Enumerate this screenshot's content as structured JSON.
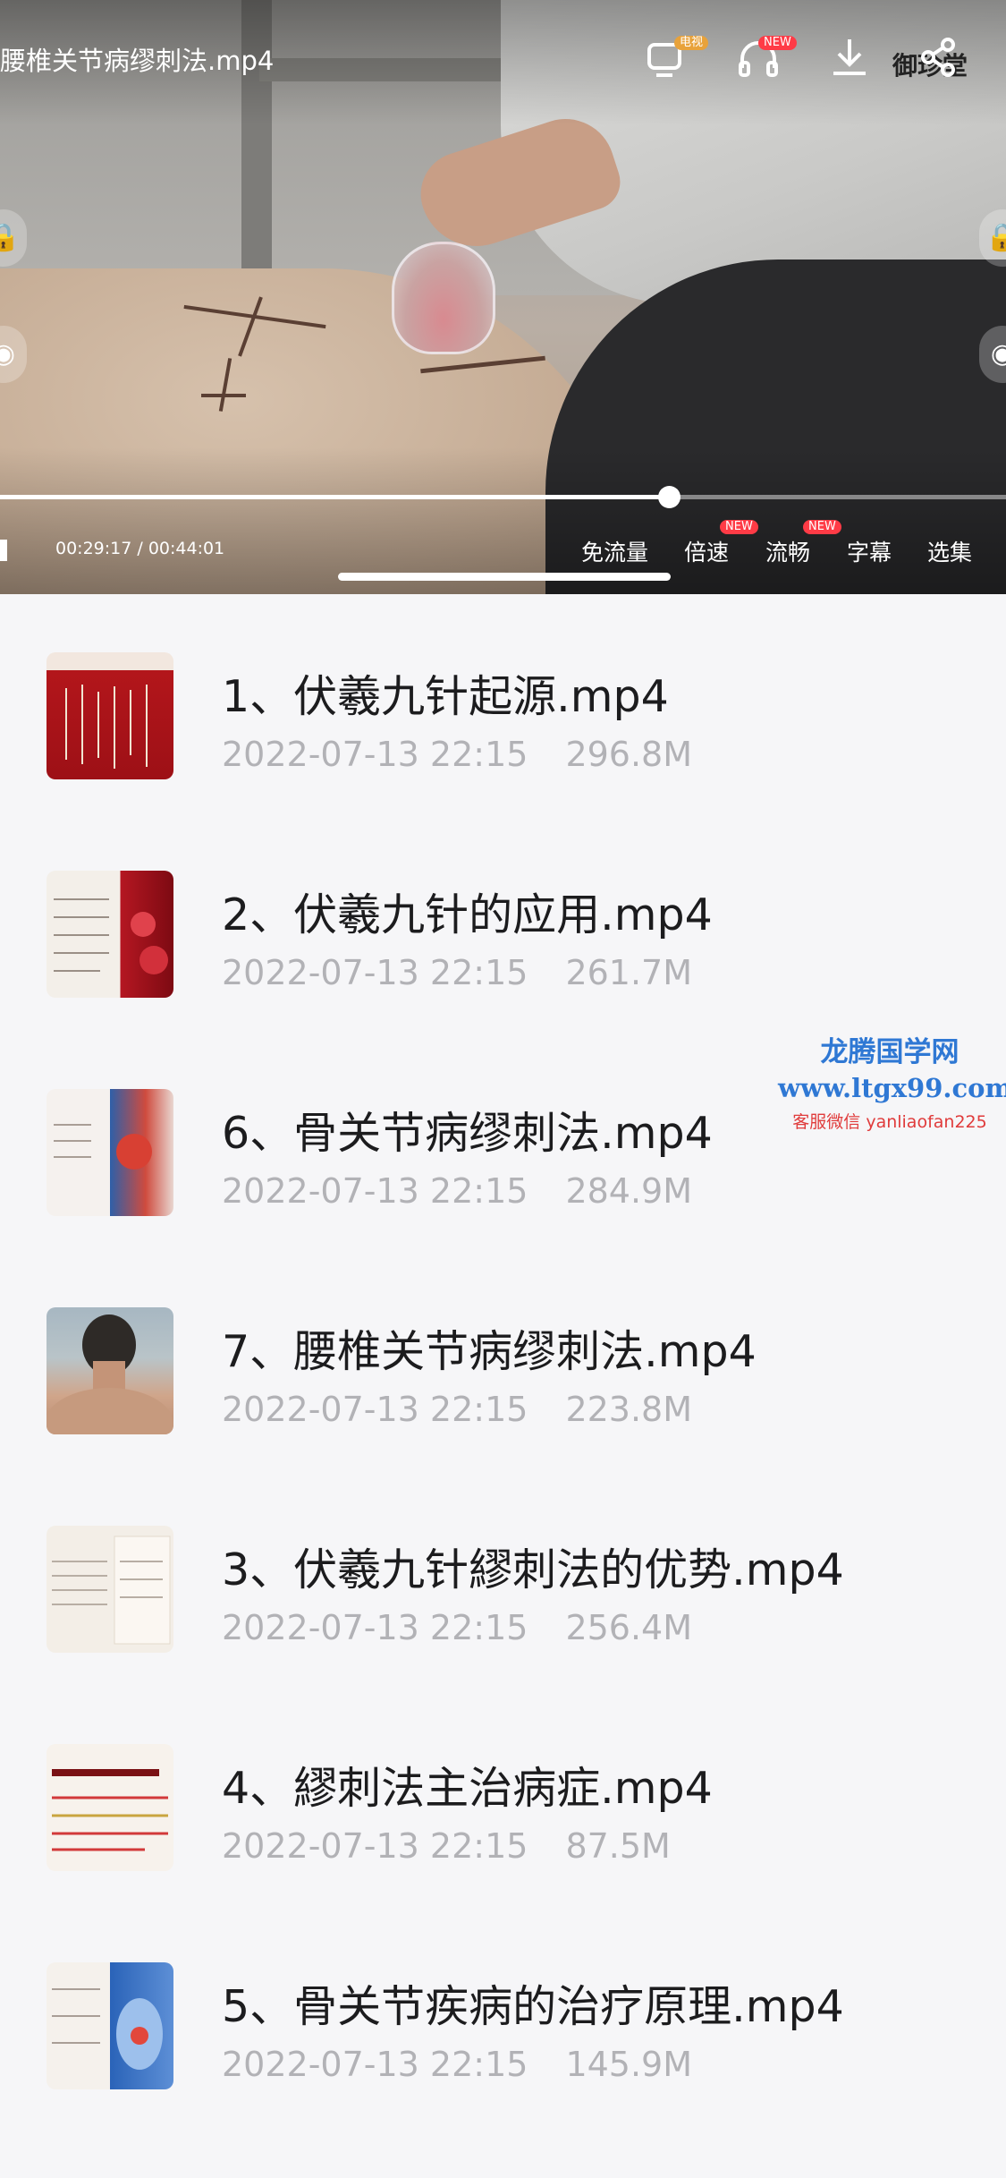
{
  "player": {
    "title": "腰椎关节病缪刺法.mp4",
    "tv_badge": "电视",
    "new_badge": "NEW",
    "watermark_logo": "御珍堂",
    "time": "00:29:17 / 00:44:01",
    "progress_fraction": 0.665,
    "controls": [
      {
        "label": "免流量",
        "new": false
      },
      {
        "label": "倍速",
        "new": true
      },
      {
        "label": "流畅",
        "new": true
      },
      {
        "label": "字幕",
        "new": false
      },
      {
        "label": "选集",
        "new": false
      }
    ]
  },
  "files": [
    {
      "name": "1、伏羲九针起源.mp4",
      "date": "2022-07-13 22:15",
      "size": "296.8M",
      "thumb": "needle-chart"
    },
    {
      "name": "2、伏羲九针的应用.mp4",
      "date": "2022-07-13 22:15",
      "size": "261.7M",
      "thumb": "blood-cells"
    },
    {
      "name": "6、骨关节病缪刺法.mp4",
      "date": "2022-07-13 22:15",
      "size": "284.9M",
      "thumb": "shoulder-anatomy"
    },
    {
      "name": "7、腰椎关节病缪刺法.mp4",
      "date": "2022-07-13 22:15",
      "size": "223.8M",
      "thumb": "neck-photo"
    },
    {
      "name": "3、伏羲九针繆刺法的优势.mp4",
      "date": "2022-07-13 22:15",
      "size": "256.4M",
      "thumb": "text-slide"
    },
    {
      "name": "4、繆刺法主治病症.mp4",
      "date": "2022-07-13 22:15",
      "size": "87.5M",
      "thumb": "red-text-slide"
    },
    {
      "name": "5、骨关节疾病的治疗原理.mp4",
      "date": "2022-07-13 22:15",
      "size": "145.9M",
      "thumb": "back-anatomy"
    }
  ],
  "watermark": {
    "title": "龙腾国学网",
    "url": "www.ltgx99.com",
    "contact": "客服微信 yanliaofan225"
  }
}
